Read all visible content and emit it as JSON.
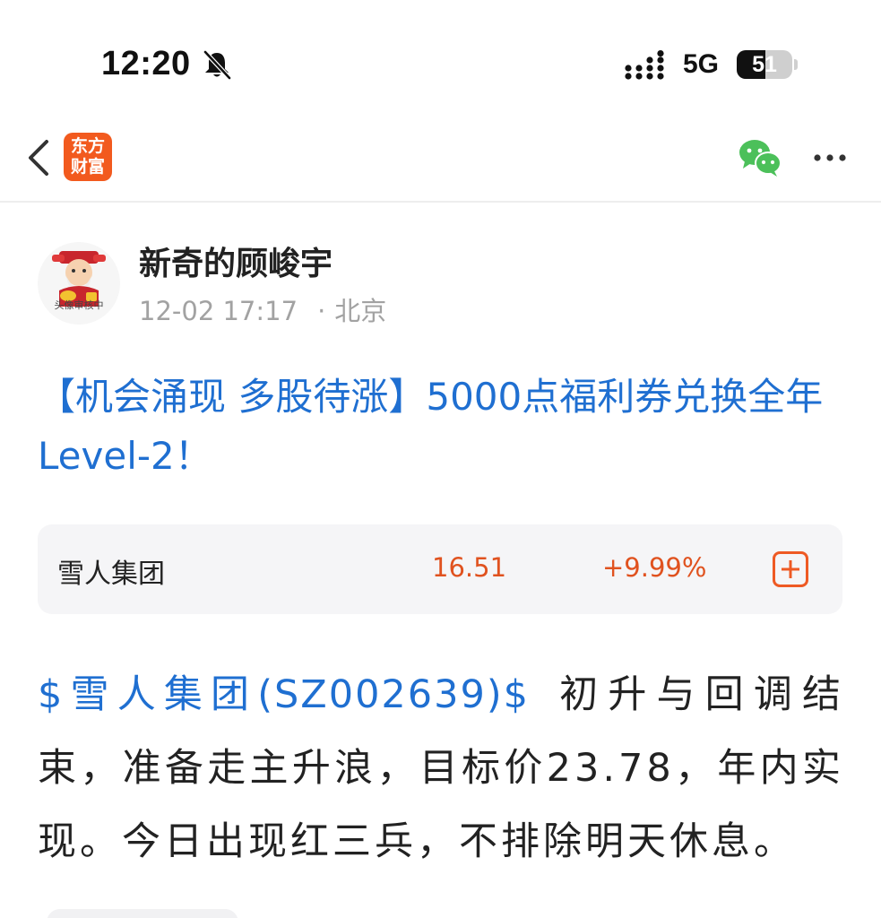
{
  "status_bar": {
    "time": "12:20",
    "network": "5G",
    "battery": "51",
    "battery_fraction": 0.51
  },
  "nav": {
    "logo_line1": "东方",
    "logo_line2": "财富",
    "logo_color": "#f25a1e",
    "icons": [
      "back-icon",
      "wechat-icon",
      "more-icon"
    ]
  },
  "post": {
    "avatar_label": "头像审核中",
    "author": "新奇的顾峻宇",
    "datetime": "12-02 17:17",
    "dot": "·",
    "location": "北京",
    "headline": "【机会涌现 多股待涨】5000点福利券兑换全年Level-2！",
    "stock": {
      "name": "雪人集团",
      "price": "16.51",
      "change": "+9.99%"
    },
    "body_link": "$雪人集团(SZ002639)$",
    "body_text": "初升与回调结束，准备走主升浪，目标价23.78，年内实现。今日出现红三兵，不排除明天休息。"
  },
  "colors": {
    "link_blue": "#1f6fd1",
    "up_red": "#e0521f",
    "wechat_green": "#4cc05a"
  }
}
